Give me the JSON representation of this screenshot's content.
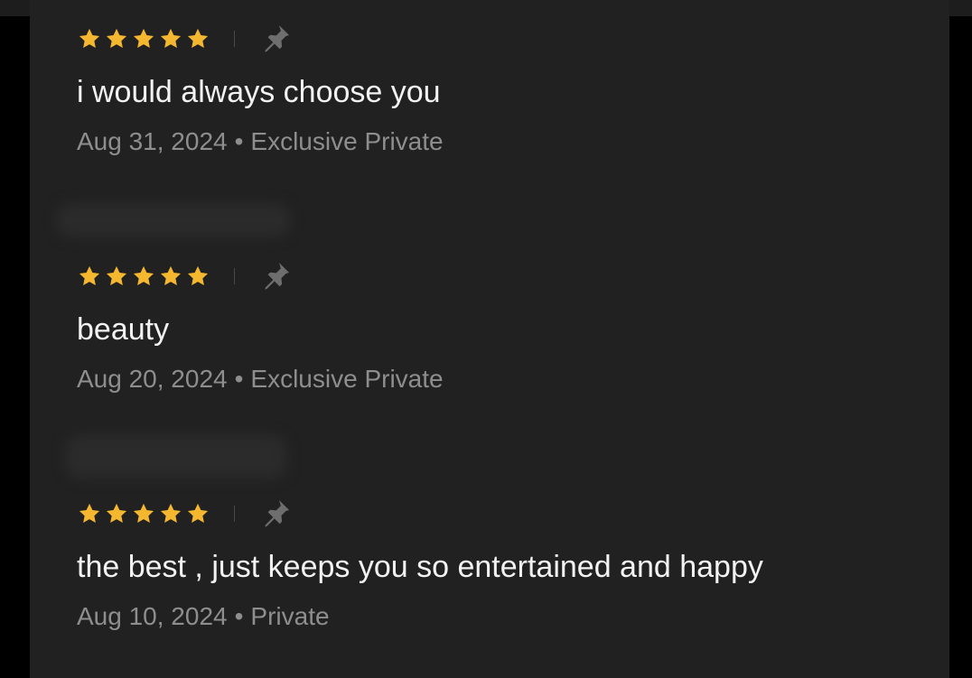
{
  "theme": {
    "star_color": "#F5B730",
    "text_color": "#F2F2F2",
    "meta_color": "#8E8E8E",
    "panel_bg": "#212121"
  },
  "reviews": [
    {
      "rating": 5,
      "pin_icon": "pin-icon",
      "text": "i would always choose you",
      "date": "Aug 31, 2024",
      "separator": "•",
      "type": "Exclusive Private"
    },
    {
      "rating": 5,
      "pin_icon": "pin-icon",
      "text": "beauty",
      "date": "Aug 20, 2024",
      "separator": "•",
      "type": "Exclusive Private"
    },
    {
      "rating": 5,
      "pin_icon": "pin-icon",
      "text": "the best , just keeps you so entertained and happy",
      "date": "Aug 10, 2024",
      "separator": "•",
      "type": "Private"
    }
  ]
}
